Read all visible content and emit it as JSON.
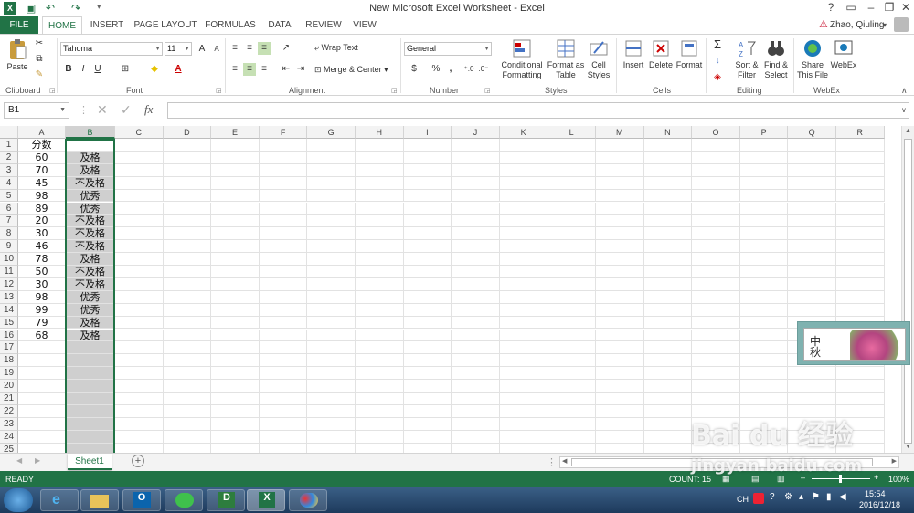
{
  "window": {
    "title": "New Microsoft Excel Worksheet - Excel",
    "help": "?",
    "user": "Zhao, Qiuling"
  },
  "tabs": [
    "FILE",
    "HOME",
    "INSERT",
    "PAGE LAYOUT",
    "FORMULAS",
    "DATA",
    "REVIEW",
    "VIEW"
  ],
  "ribbon": {
    "clipboard": {
      "label": "Clipboard",
      "paste": "Paste"
    },
    "font": {
      "label": "Font",
      "name": "Tahoma",
      "size": "11",
      "bold": "B",
      "italic": "I",
      "underline": "U",
      "grow": "A",
      "shrink": "A"
    },
    "alignment": {
      "label": "Alignment",
      "wrap": "Wrap Text",
      "merge": "Merge & Center"
    },
    "number": {
      "label": "Number",
      "format": "General",
      "percent": "%",
      "comma": ","
    },
    "styles": {
      "label": "Styles",
      "cond1": "Conditional",
      "cond2": "Formatting",
      "fmt1": "Format as",
      "fmt2": "Table",
      "cell1": "Cell",
      "cell2": "Styles"
    },
    "cells": {
      "label": "Cells",
      "insert": "Insert",
      "delete": "Delete",
      "format": "Format"
    },
    "editing": {
      "label": "Editing",
      "sort1": "Sort &",
      "sort2": "Filter",
      "find1": "Find &",
      "find2": "Select"
    },
    "webex": {
      "label": "WebEx",
      "share1": "Share",
      "share2": "This File",
      "webex": "WebEx"
    }
  },
  "formula_bar": {
    "name_box": "B1",
    "fx": "fx",
    "value": ""
  },
  "sheet": {
    "columns": [
      "A",
      "B",
      "C",
      "D",
      "E",
      "F",
      "G",
      "H",
      "I",
      "J",
      "K",
      "L",
      "M",
      "N",
      "O",
      "P",
      "Q",
      "R"
    ],
    "rows": [
      "1",
      "2",
      "3",
      "4",
      "5",
      "6",
      "7",
      "8",
      "9",
      "10",
      "11",
      "12",
      "13",
      "14",
      "15",
      "16",
      "17",
      "18",
      "19",
      "20",
      "21",
      "22",
      "23",
      "24",
      "25"
    ],
    "col_a": [
      "分数",
      "60",
      "70",
      "45",
      "98",
      "89",
      "20",
      "30",
      "46",
      "78",
      "50",
      "30",
      "98",
      "99",
      "79",
      "68"
    ],
    "col_b": [
      "",
      "及格",
      "及格",
      "不及格",
      "优秀",
      "优秀",
      "不及格",
      "不及格",
      "不及格",
      "及格",
      "不及格",
      "不及格",
      "优秀",
      "优秀",
      "及格",
      "及格"
    ],
    "selected_column": "B",
    "active_cell": "B1"
  },
  "sheet_tabs": {
    "active": "Sheet1",
    "add": "+"
  },
  "status": {
    "ready": "READY",
    "count": "COUNT: 15",
    "zoom": "100%"
  },
  "ad": {
    "text": "中秋"
  },
  "taskbar": {
    "lang": "CH",
    "time": "15:54",
    "date": "2016/12/18"
  },
  "watermark": {
    "text": "Bai du 经验",
    "url": "jingyan.baidu.com"
  },
  "colors": {
    "accent": "#217346",
    "selected_col": "#cfcfcf"
  }
}
